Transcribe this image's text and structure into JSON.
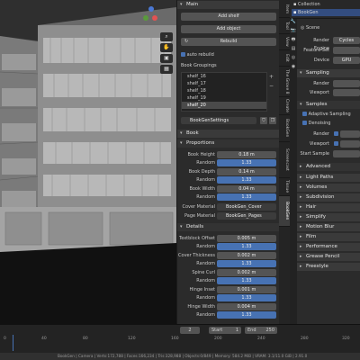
{
  "colors": {
    "accent_blue": "#4772b3",
    "panel_bg": "#2b2b2b",
    "viewport_bg": "#3d3d3d"
  },
  "npanel": {
    "main_header": "Main",
    "add_shelf": "Add shelf",
    "add_object": "Add object",
    "rebuild": "Rebuild",
    "autorebuild": "auto rebuild",
    "book_groupings": "Book Groupings",
    "groupings": [
      "shelf_16",
      "shelf_17",
      "shelf_18",
      "shelf_19",
      "shelf_20"
    ],
    "settings_name": "BookGenSettings",
    "book_header": "Book",
    "proportions_header": "Proportions",
    "book_height": {
      "label": "Book Height",
      "value": "0.18 m",
      "random_label": "Random",
      "random": "1.33"
    },
    "book_depth": {
      "label": "Book Depth",
      "value": "0.14 m",
      "random_label": "Random",
      "random": "1.33"
    },
    "book_width": {
      "label": "Book Width",
      "value": "0.04 m",
      "random_label": "Random",
      "random": "1.33"
    },
    "cover_material": {
      "label": "Cover Material",
      "value": "BookGen_Cover"
    },
    "page_material": {
      "label": "Page Material",
      "value": "BookGen_Pages"
    },
    "details_header": "Details",
    "textblock_offset": {
      "label": "Textblock Offset",
      "value": "0.005 m",
      "random_label": "Random",
      "random": "1.33"
    },
    "cover_thickness": {
      "label": "Cover Thickness",
      "value": "0.002 m",
      "random_label": "Random",
      "random": "1.33"
    },
    "spine_curl": {
      "label": "Spine Curl",
      "value": "0.002 m",
      "random_label": "Random",
      "random": "1.33"
    },
    "hinge_inset": {
      "label": "Hinge Inset",
      "value": "0.001 m",
      "random_label": "Random",
      "random": "1.33"
    },
    "hinge_width": {
      "label": "Hinge Width",
      "value": "0.004 m",
      "random_label": "Random",
      "random": "1.33"
    }
  },
  "vtabs": [
    "Item",
    "Tool",
    "View",
    "Edit",
    "The Grove 8",
    "Create",
    "BookGen",
    "Screencast",
    "Tissue",
    "BookGen"
  ],
  "outliner": {
    "items": [
      "Collection",
      "BookGen"
    ]
  },
  "props": {
    "scene_label": "Scene",
    "render_engine_label": "Render Engine",
    "render_engine": "Cycles",
    "feature_set_label": "Feature Set",
    "device_label": "Device",
    "device": "GPU",
    "sampling_header": "Sampling",
    "render_label": "Render",
    "viewport_label": "Viewport",
    "samples_label": "Samples",
    "adaptive_sampling": "Adaptive Sampling",
    "denoising": "Denoising",
    "start_sample": "Start Sample",
    "advanced": "Advanced",
    "sections": [
      "Light Paths",
      "Volumes",
      "Subdivision",
      "Hair",
      "Simplify",
      "Motion Blur",
      "Film",
      "Performance",
      "Grease Pencil",
      "Freestyle"
    ]
  },
  "timeline": {
    "ticks": [
      "0",
      "40",
      "80",
      "120",
      "160",
      "200",
      "240",
      "280",
      "320"
    ],
    "current_frame": "2",
    "start_label": "Start",
    "start": "1",
    "end_label": "End",
    "end": "250"
  },
  "status": "BookGen | Camera | Verts:172,788 | Faces:166,234 | Tris:328,988 | Objects:0/849 | Memory: 584.2 MiB | VRAM: 3.1/11.0 GiB | 2.91.0"
}
